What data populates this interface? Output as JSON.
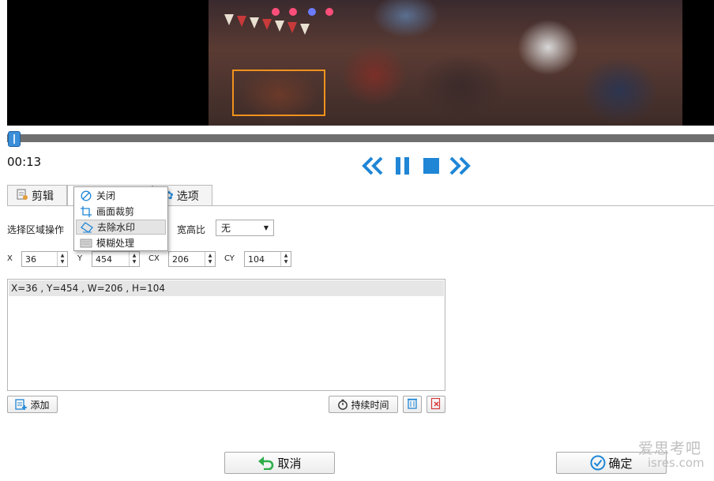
{
  "player": {
    "time": "00:13",
    "controls": [
      "rewind",
      "pause",
      "stop",
      "fast-forward"
    ],
    "seek_progress": 0.005
  },
  "tabs": {
    "clip_label": "剪辑",
    "options_label": "选项"
  },
  "region": {
    "operation_label": "选择区域操作",
    "aspect_label": "宽高比",
    "aspect_value": "无",
    "x_label": "X",
    "x_value": "36",
    "y_label": "Y",
    "y_value": "454",
    "cx_label": "CX",
    "cx_value": "206",
    "cy_label": "CY",
    "cy_value": "104"
  },
  "list": {
    "rows": [
      "X=36 , Y=454 , W=206 , H=104"
    ]
  },
  "menu": {
    "items": [
      {
        "label": "关闭",
        "icon": "disabled-circle-icon"
      },
      {
        "label": "画面裁剪",
        "icon": "crop-icon"
      },
      {
        "label": "去除水印",
        "icon": "eraser-icon",
        "highlighted": true
      },
      {
        "label": "模糊处理",
        "icon": "blur-icon"
      }
    ]
  },
  "buttons": {
    "add": "添加",
    "duration": "持续时间",
    "cancel": "取消",
    "confirm": "确定"
  },
  "watermark": {
    "line1": "爱思考吧",
    "line2": "isres.com"
  },
  "colors": {
    "accent": "#1f86d6",
    "selection_box": "#f0921e",
    "delete_red": "#d83a3a"
  }
}
